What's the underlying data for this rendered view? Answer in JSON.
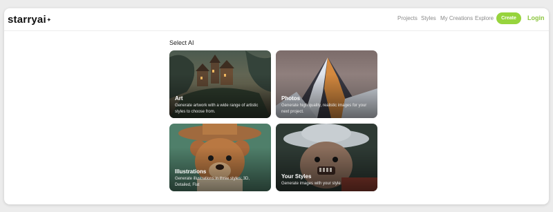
{
  "nav": {
    "logo": "starryai",
    "logo_mark": "✦",
    "links": [
      "Projects",
      "Styles",
      "My Creations",
      "Explore"
    ],
    "create_label": "Create",
    "login_label": "Login"
  },
  "main": {
    "heading": "Select AI",
    "cards": [
      {
        "title": "Art",
        "description": "Generate artwork with a wide range of artistic styles to choose from."
      },
      {
        "title": "Photos",
        "description": "Generate high quality, realistic images for your next project."
      },
      {
        "title": "Illustrations",
        "description": "Generate illustrations in three styles: 3D, Detailed, Flat"
      },
      {
        "title": "Your Styles",
        "description": "Generate images with your style"
      }
    ]
  },
  "colors": {
    "accent": "#97d43d",
    "login": "#8cc63f"
  }
}
